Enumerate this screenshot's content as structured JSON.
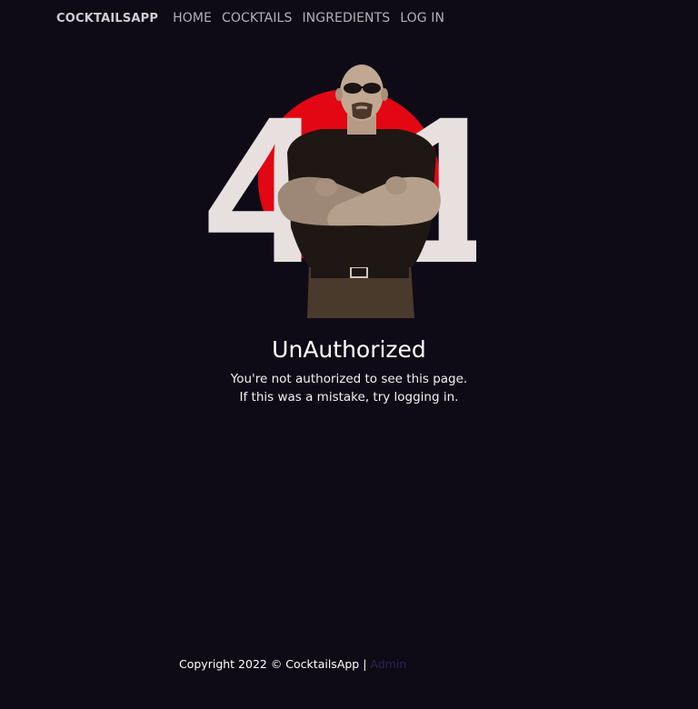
{
  "navbar": {
    "brand": "COCKTAILSAPP",
    "links": [
      "HOME",
      "COCKTAILS",
      "INGREDIENTS",
      "LOG IN"
    ]
  },
  "hero": {
    "code_left": "4",
    "code_right": "1",
    "circle_color": "#e30613",
    "digit_color": "#e7e0df"
  },
  "error": {
    "title": "UnAuthorized",
    "line1": "You're not authorized to see this page.",
    "line2": "If this was a mistake, try logging in."
  },
  "footer": {
    "copyright": "Copyright 2022 © CocktailsApp |",
    "admin_link": "Admin"
  }
}
